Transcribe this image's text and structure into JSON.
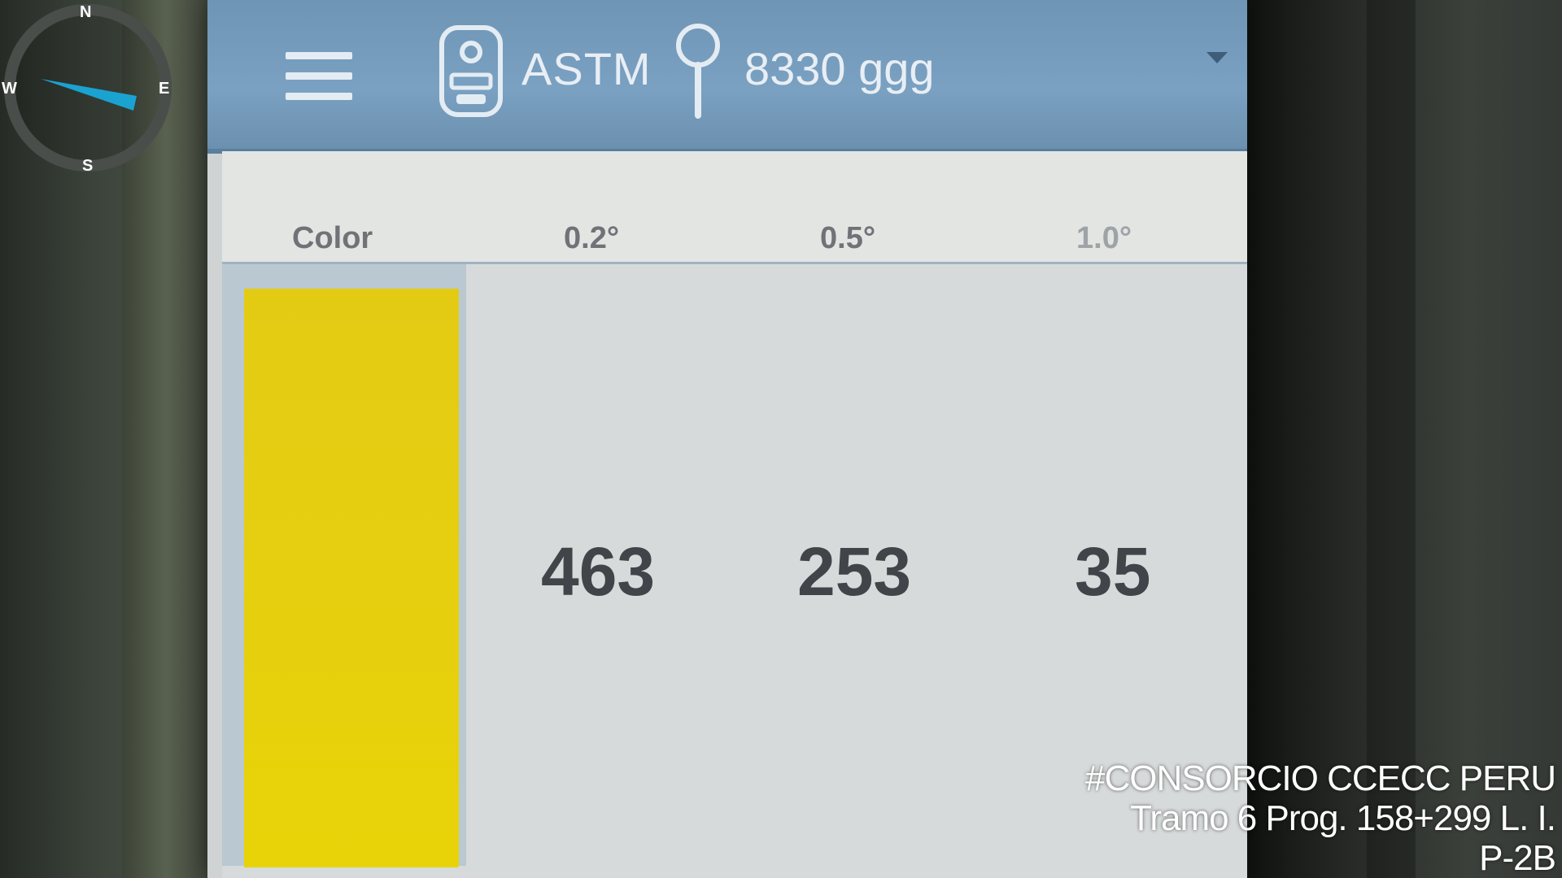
{
  "appbar": {
    "menu_icon": "hamburger-menu-icon",
    "device_icon": "retroreflectometer-device-icon",
    "standard": "ASTM",
    "location_icon": "location-pin-icon",
    "sample": "8330 ggg",
    "dropdown_icon": "chevron-down-icon"
  },
  "table": {
    "columns": [
      "Color",
      "0.2°",
      "0.5°",
      "1.0°"
    ],
    "row": {
      "color_swatch": "#E6CF0F",
      "values": [
        "463",
        "253",
        "35"
      ]
    }
  },
  "compass": {
    "north": "N",
    "east": "E",
    "south": "S",
    "west": "W",
    "needle_color": "#1AA3D1"
  },
  "watermark": {
    "line1": "#CONSORCIO CCECC PERU",
    "line2": "Tramo 6 Prog. 158+299 L. I.",
    "line3": "P-2B"
  }
}
